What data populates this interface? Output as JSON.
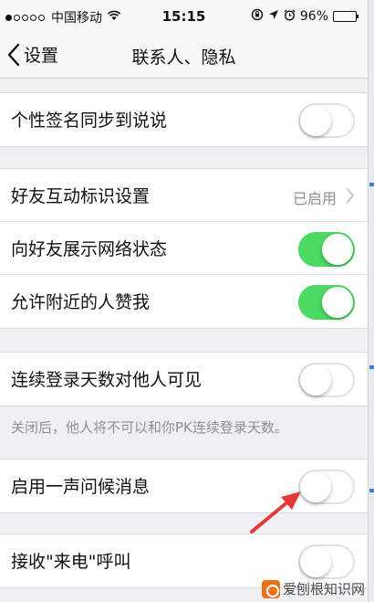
{
  "status_bar": {
    "signal_bars_filled": 1,
    "signal_bars_total": 5,
    "carrier": "中国移动",
    "time": "15:15",
    "battery_percent": "96%",
    "battery_level": 0.96,
    "icons": [
      "wifi-icon",
      "rotation-lock-icon",
      "location-icon",
      "alarm-icon",
      "battery-icon"
    ]
  },
  "nav": {
    "back_label": "设置",
    "title": "联系人、隐私"
  },
  "sections": [
    {
      "rows": [
        {
          "label": "个性签名同步到说说",
          "control": "toggle",
          "on": false
        }
      ]
    },
    {
      "rows": [
        {
          "label": "好友互动标识设置",
          "control": "disclosure",
          "value": "已启用"
        },
        {
          "label": "向好友展示网络状态",
          "control": "toggle",
          "on": true
        },
        {
          "label": "允许附近的人赞我",
          "control": "toggle",
          "on": true
        }
      ]
    },
    {
      "rows": [
        {
          "label": "连续登录天数对他人可见",
          "control": "toggle",
          "on": false
        }
      ],
      "footer": "关闭后，他人将不可以和你PK连续登录天数。"
    },
    {
      "rows": [
        {
          "label": "启用一声问候消息",
          "control": "toggle",
          "on": false
        }
      ]
    },
    {
      "rows": [
        {
          "label": "接收\"来电\"呼叫",
          "control": "toggle",
          "on": false
        }
      ]
    }
  ],
  "annotation": {
    "arrow_color": "#e53935"
  },
  "watermark": {
    "text": "爱刨根知识网"
  },
  "colors": {
    "toggle_on": "#4cd964",
    "background": "#efeff4",
    "secondary_text": "#8e8e93"
  }
}
